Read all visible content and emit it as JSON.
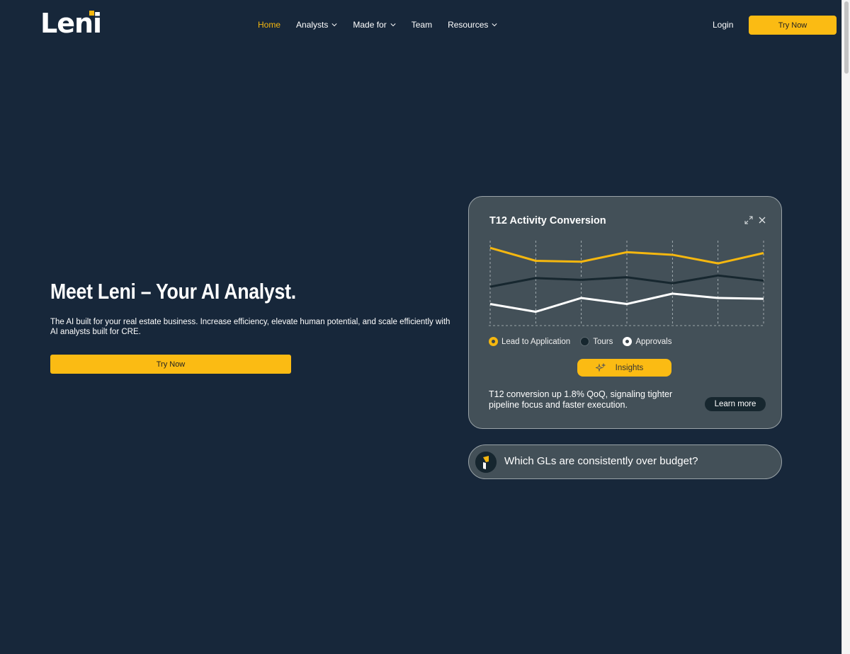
{
  "brand": {
    "logo_text": "Leni",
    "accent": "#f5b70f"
  },
  "nav": {
    "items": [
      {
        "label": "Home",
        "active": true,
        "dropdown": false
      },
      {
        "label": "Analysts",
        "active": false,
        "dropdown": true
      },
      {
        "label": "Made for",
        "active": false,
        "dropdown": true
      },
      {
        "label": "Team",
        "active": false,
        "dropdown": false
      },
      {
        "label": "Resources",
        "active": false,
        "dropdown": true
      }
    ],
    "login_label": "Login",
    "cta_label": "Try Now"
  },
  "hero": {
    "title": "Meet Leni – Your AI Analyst.",
    "subtitle": "The AI built for your real estate business. Increase efficiency, elevate human potential, and scale efficiently with AI analysts built for CRE.",
    "cta_label": "Try Now"
  },
  "card": {
    "title": "T12 Activity Conversion",
    "legend": [
      {
        "label": "Lead to Application",
        "color": "#f5b70f"
      },
      {
        "label": "Tours",
        "color": "#17272f"
      },
      {
        "label": "Approvals",
        "color": "#ffffff"
      }
    ],
    "insights_label": "Insights",
    "insight_text": "T12 conversion up 1.8% QoQ, signaling tighter pipeline focus and faster execution.",
    "learn_more_label": "Learn more"
  },
  "chart_data": {
    "type": "line",
    "title": "T12 Activity Conversion",
    "x": [
      1,
      2,
      3,
      4,
      5,
      6,
      7
    ],
    "ylim": [
      0,
      100
    ],
    "grid": "vertical dashed",
    "series": [
      {
        "name": "Lead to Application",
        "values": [
          90,
          75,
          74,
          85,
          82,
          72,
          84
        ]
      },
      {
        "name": "Tours",
        "values": [
          45,
          55,
          53,
          56,
          49,
          58,
          52
        ]
      },
      {
        "name": "Approvals",
        "values": [
          25,
          16,
          32,
          25,
          37,
          32,
          31
        ]
      }
    ]
  },
  "question": {
    "text": "Which GLs are consistently over budget?"
  }
}
